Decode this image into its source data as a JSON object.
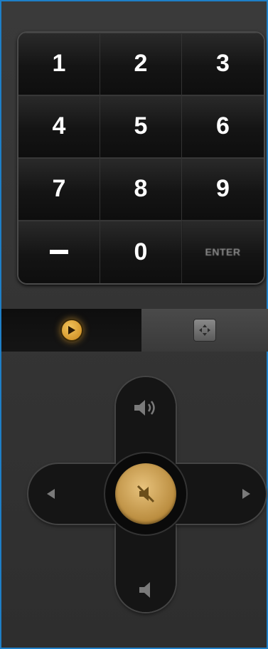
{
  "keypad": {
    "keys": [
      {
        "label": "1"
      },
      {
        "label": "2"
      },
      {
        "label": "3"
      },
      {
        "label": "4"
      },
      {
        "label": "5"
      },
      {
        "label": "6"
      },
      {
        "label": "7"
      },
      {
        "label": "8"
      },
      {
        "label": "9"
      },
      {
        "label": ""
      },
      {
        "label": "0"
      },
      {
        "label": "ENTER"
      }
    ]
  },
  "mode_tabs": {
    "active": "playback",
    "items": [
      {
        "name": "playback",
        "icon": "play-icon"
      },
      {
        "name": "navigation",
        "icon": "dpad-icon"
      }
    ]
  },
  "colors": {
    "accent_gold": "#e0a832",
    "frame_border": "#1e7fc7",
    "background": "#2b2b2b"
  },
  "cross_pad": {
    "up": {
      "icon": "volume-up-icon"
    },
    "down": {
      "icon": "volume-down-icon"
    },
    "left": {
      "icon": "left-arrow-icon"
    },
    "right": {
      "icon": "right-arrow-icon"
    },
    "center": {
      "icon": "mute-icon"
    }
  }
}
